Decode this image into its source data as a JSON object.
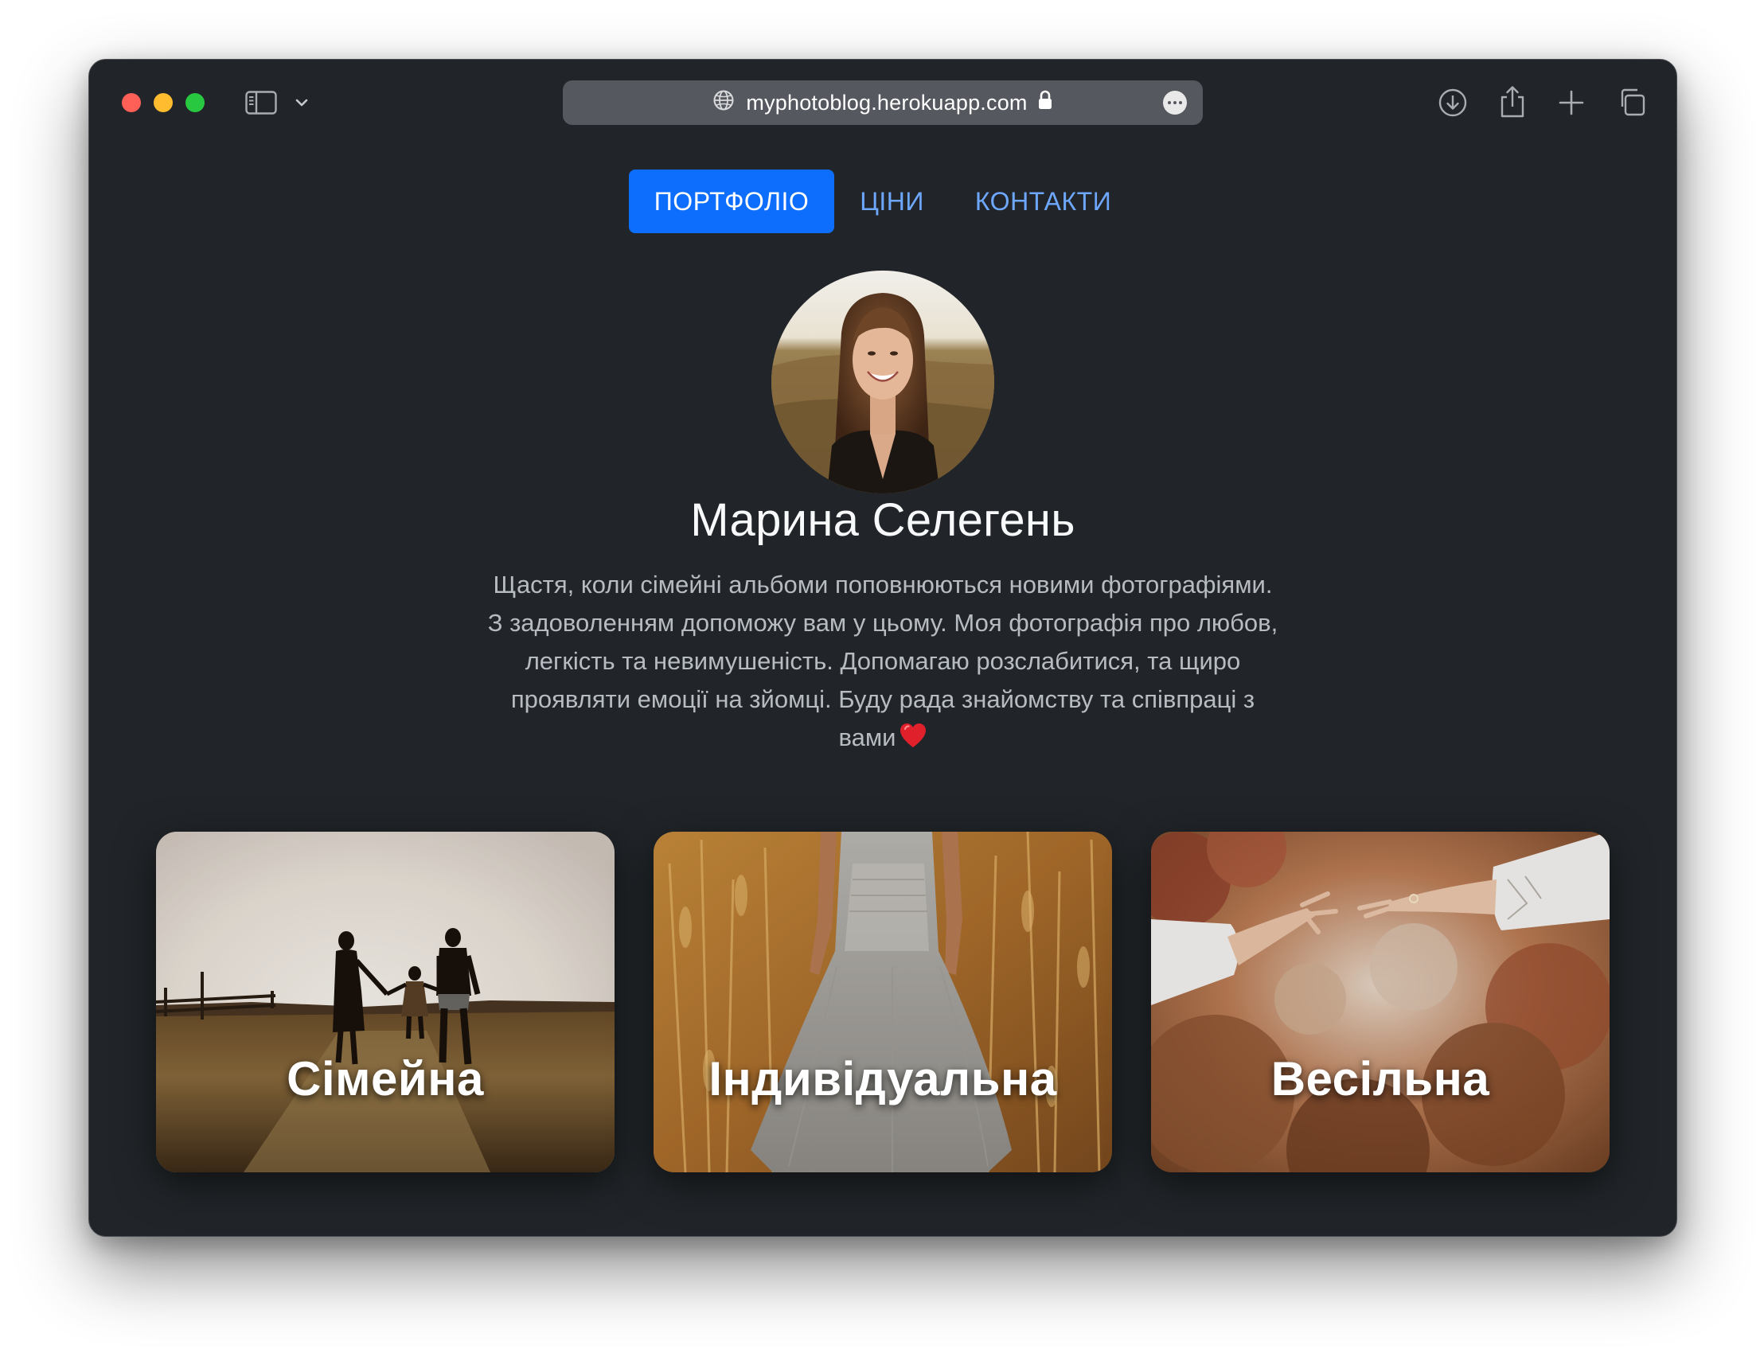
{
  "browser": {
    "url": "myphotoblog.herokuapp.com",
    "icons": [
      "sidebar-icon",
      "chevron-down-icon",
      "globe-icon",
      "lock-icon",
      "more-icon",
      "download-icon",
      "share-icon",
      "plus-icon",
      "tabs-icon"
    ]
  },
  "nav": {
    "items": [
      {
        "label": "ПОРТФОЛІО",
        "active": true
      },
      {
        "label": "ЦІНИ",
        "active": false
      },
      {
        "label": "КОНТАКТИ",
        "active": false
      }
    ]
  },
  "profile": {
    "name": "Марина Селегень",
    "bio_lines": [
      "Щастя, коли сімейні альбоми поповнюються новими фотографіями.",
      "З задоволенням допоможу вам у цьому. Моя фотографія про любов,",
      "легкість та невимушеність. Допомагаю розслабитися, та щиро",
      "проявляти емоції на зйомці. Буду рада знайомству та співпраці з",
      "вами"
    ]
  },
  "cards": [
    {
      "title": "Сімейна"
    },
    {
      "title": "Індивідуальна"
    },
    {
      "title": "Весільна"
    }
  ],
  "colors": {
    "page_bg": "#212529",
    "nav_active_bg": "#0d6efd",
    "nav_link": "#6ea8fe",
    "bio_text": "#b7bcc2"
  }
}
